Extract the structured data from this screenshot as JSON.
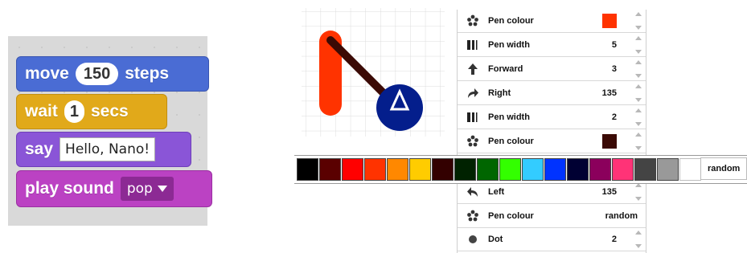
{
  "scratch": {
    "move": {
      "keyword": "move",
      "amount": "150",
      "unit": "steps"
    },
    "wait": {
      "keyword": "wait",
      "amount": "1",
      "unit": "secs"
    },
    "say": {
      "keyword": "say",
      "text": "Hello, Nano!"
    },
    "play": {
      "keyword": "play sound",
      "sound": "pop"
    }
  },
  "commands": [
    {
      "label": "Pen colour",
      "icon": "palette-icon",
      "swatch": "#ff3300"
    },
    {
      "label": "Pen width",
      "icon": "pen-width-icon",
      "value": "5"
    },
    {
      "label": "Forward",
      "icon": "arrow-up-icon",
      "value": "3"
    },
    {
      "label": "Right",
      "icon": "turn-right-icon",
      "value": "135"
    },
    {
      "label": "Pen width",
      "icon": "pen-width-icon",
      "value": "2"
    },
    {
      "label": "Pen colour",
      "icon": "palette-icon",
      "swatch": "#3b0a05"
    },
    {
      "label": "Left",
      "icon": "turn-left-icon",
      "value": "135"
    },
    {
      "label": "Pen colour",
      "icon": "palette-icon",
      "value": "random"
    },
    {
      "label": "Dot",
      "icon": "dot-icon",
      "value": "2"
    }
  ],
  "palette": {
    "colors": [
      "#000000",
      "#5a0000",
      "#ff0000",
      "#ff3300",
      "#ff8800",
      "#ffcc00",
      "#330000",
      "#002200",
      "#006600",
      "#33ff00",
      "#33ccff",
      "#0033ff",
      "#000033",
      "#8b005c",
      "#ff3377",
      "#444444",
      "#999999",
      "#ffffff"
    ],
    "random_label": "random"
  },
  "colors": {
    "thick_line": "#ff3300",
    "thin_line": "#3b0a05",
    "turtle": "#041e8c"
  }
}
